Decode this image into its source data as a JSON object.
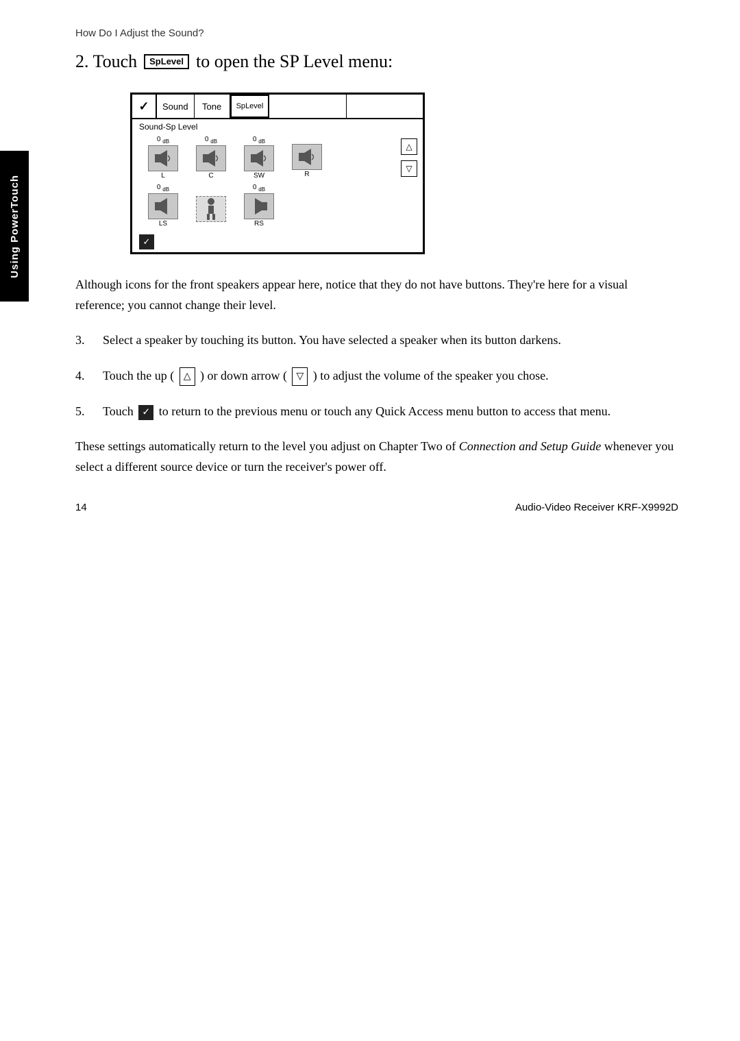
{
  "breadcrumb": "How Do I Adjust the Sound?",
  "step2": {
    "prefix": "2. Touch",
    "suffix": "to open the SP Level menu:",
    "sp_icon_line1": "Sp",
    "sp_icon_line2": "Level"
  },
  "screen": {
    "tabs": {
      "checkmark": "✓",
      "sound": "Sound",
      "tone": "Tone",
      "sp_level_line1": "Sp",
      "sp_level_line2": "Level",
      "empty1": "",
      "empty2": ""
    },
    "subtitle": "Sound-Sp Level",
    "speakers": {
      "top_row": [
        {
          "db": "0 dB",
          "label": "L",
          "icon": "🔈"
        },
        {
          "db": "0 dB",
          "label": "C",
          "icon": "🔈"
        },
        {
          "db": "0 dB",
          "label": "SW",
          "icon": "🔈"
        },
        {
          "db": "",
          "label": "R",
          "icon": "🔈"
        }
      ],
      "bottom_row": [
        {
          "db": "0 dB",
          "label": "LS",
          "icon": "🔈"
        },
        {
          "db": "",
          "label": "",
          "icon": "🚶"
        },
        {
          "db": "0 dB",
          "label": "RS",
          "icon": "🔈"
        }
      ]
    },
    "up_arrow": "△",
    "down_arrow": "▽",
    "back_icon": "✓"
  },
  "body_text": "Although icons for the front speakers appear here, notice that they do not have buttons. They're here for a visual reference; you cannot change their level.",
  "steps": [
    {
      "num": "3.",
      "text": "Select a speaker by touching its button. You have selected a speaker when its button darkens."
    },
    {
      "num": "4.",
      "text_before": "Touch the up (",
      "up_symbol": "△",
      "text_mid": ") or down arrow (",
      "down_symbol": "▽",
      "text_after": ") to adjust the volume of the speaker you chose.",
      "type": "arrows"
    },
    {
      "num": "5.",
      "text_before": "Touch",
      "text_after": "to return to the previous menu or touch any Quick Access menu button to access that menu.",
      "type": "back"
    }
  ],
  "closing_text": {
    "normal": "These settings automatically return to the level you adjust on Chapter Two of ",
    "italic": "Connection and Setup Guide",
    "normal2": " whenever you select a different source device or turn the receiver's power off."
  },
  "footer": {
    "page_num": "14",
    "product": "Audio-Video Receiver KRF-X9992D"
  },
  "side_tab": "Using PowerTouch"
}
